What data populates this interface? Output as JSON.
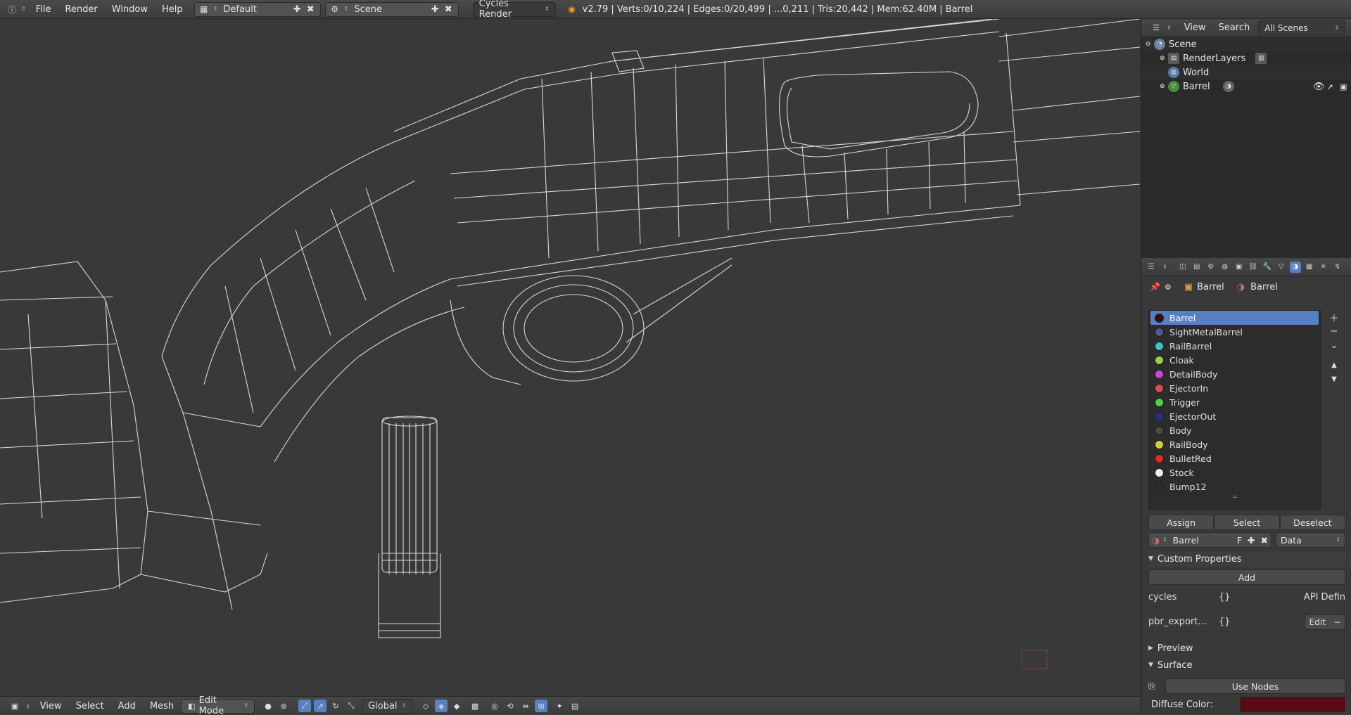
{
  "topbar": {
    "menus": [
      "File",
      "Render",
      "Window",
      "Help"
    ],
    "layout": "Default",
    "scene": "Scene",
    "engine": "Cycles Render",
    "stats": "v2.79 | Verts:0/10,224 | Edges:0/20,499 | ...0,211 | Tris:20,442 | Mem:62.40M | Barrel"
  },
  "viewbar": {
    "menus": [
      "View",
      "Select",
      "Add",
      "Mesh"
    ],
    "mode": "Edit Mode",
    "orientation": "Global"
  },
  "outliner": {
    "menus": [
      "View",
      "Search"
    ],
    "filter": "All Scenes",
    "items": [
      {
        "label": "Scene"
      },
      {
        "label": "RenderLayers"
      },
      {
        "label": "World"
      },
      {
        "label": "Barrel"
      }
    ]
  },
  "properties": {
    "context": {
      "object": "Barrel",
      "material": "Barrel"
    },
    "slots": [
      {
        "name": "Barrel",
        "color": "#3a0d12"
      },
      {
        "name": "SightMetalBarrel",
        "color": "#4b5a96"
      },
      {
        "name": "RailBarrel",
        "color": "#3cc4c8"
      },
      {
        "name": "Cloak",
        "color": "#9bd23c"
      },
      {
        "name": "DetailBody",
        "color": "#c64bd0"
      },
      {
        "name": "EjectorIn",
        "color": "#d84a56"
      },
      {
        "name": "Trigger",
        "color": "#4fd04a"
      },
      {
        "name": "EjectorOut",
        "color": "#2a2e8c"
      },
      {
        "name": "Body",
        "color": "#4a4a4a"
      },
      {
        "name": "RailBody",
        "color": "#c8d23c"
      },
      {
        "name": "BulletRed",
        "color": "#e02828"
      },
      {
        "name": "Stock",
        "color": "#f0f0f0"
      },
      {
        "name": "Bump12",
        "color": "#2c2c2c"
      }
    ],
    "buttons": {
      "assign": "Assign",
      "select": "Select",
      "deselect": "Deselect"
    },
    "material_field": {
      "name": "Barrel",
      "flag": "F",
      "link": "Data"
    },
    "custom_properties": {
      "title": "Custom Properties",
      "add": "Add",
      "rows": [
        {
          "key": "cycles",
          "value": "{}",
          "action": "API Defin"
        },
        {
          "key": "pbr_export...",
          "value": "{}",
          "action": "Edit"
        }
      ]
    },
    "preview": "Preview",
    "surface": "Surface",
    "use_nodes": "Use Nodes",
    "diffuse_label": "Diffuse Color:",
    "diffuse_color": "#5a0a12"
  }
}
